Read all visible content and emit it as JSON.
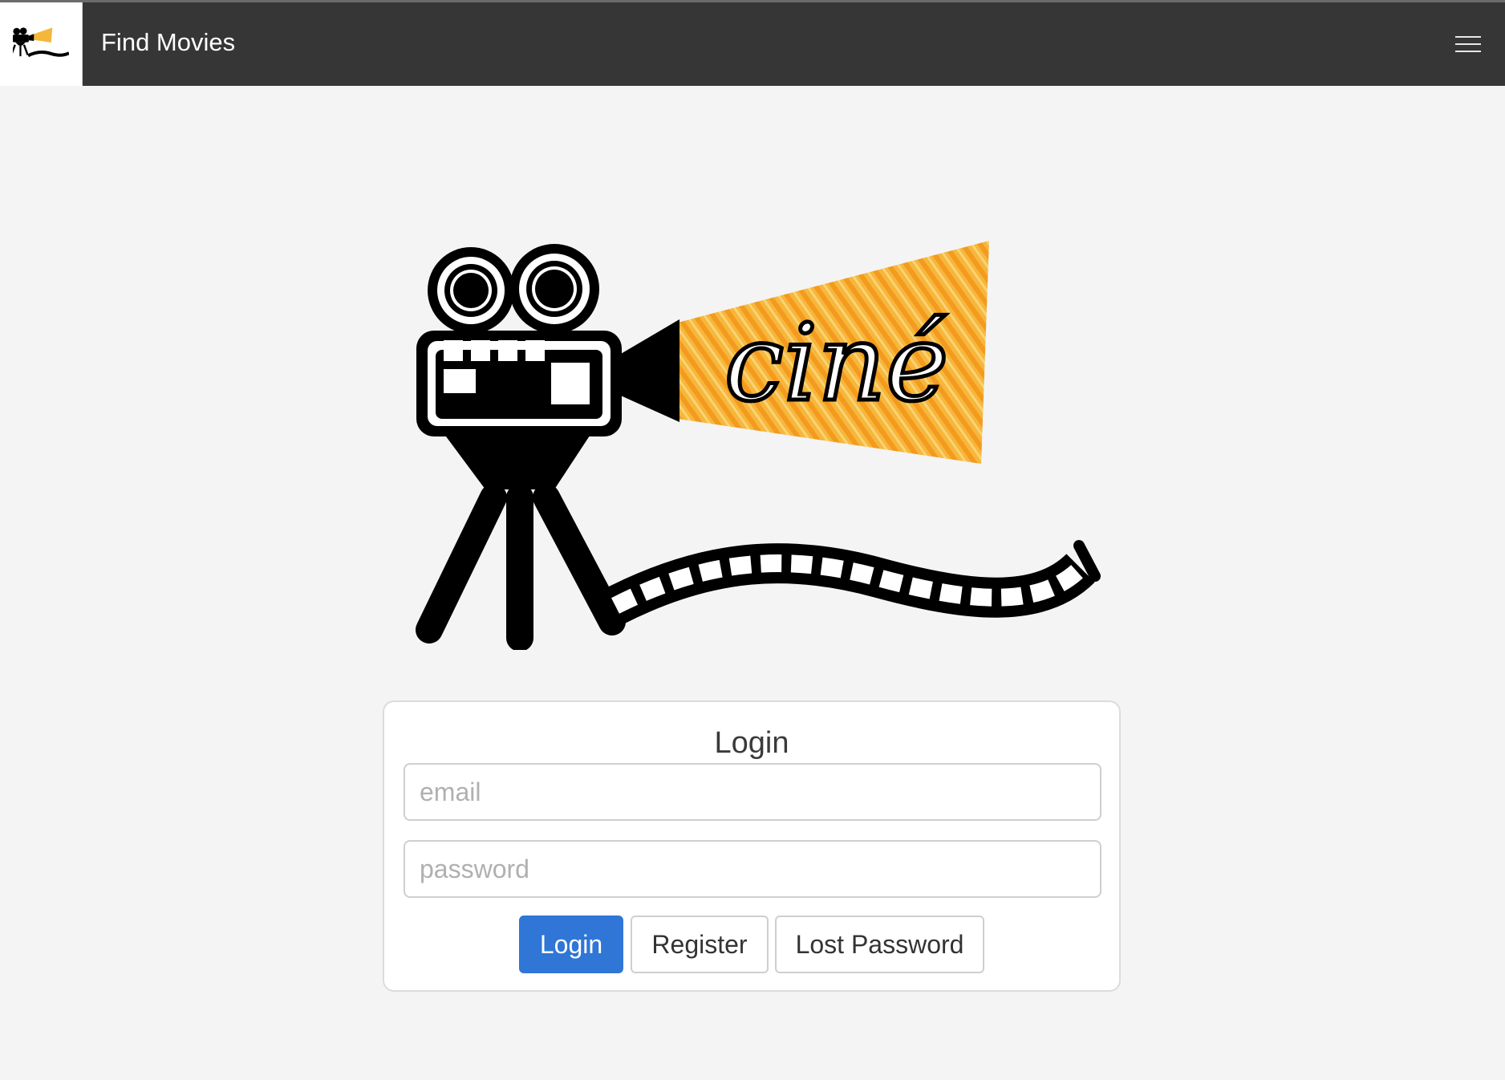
{
  "navbar": {
    "title": "Find Movies",
    "menu_icon": "hamburger-menu-icon"
  },
  "logo": {
    "icon": "cine-movie-camera-logo",
    "text": "ciné",
    "accent": "#f5a623"
  },
  "login": {
    "title": "Login",
    "email_placeholder": "email",
    "password_placeholder": "password",
    "login_label": "Login",
    "register_label": "Register",
    "lost_password_label": "Lost Password"
  },
  "colors": {
    "navbar": "#363636",
    "primary": "#2f76d6",
    "background": "#f4f4f4"
  }
}
